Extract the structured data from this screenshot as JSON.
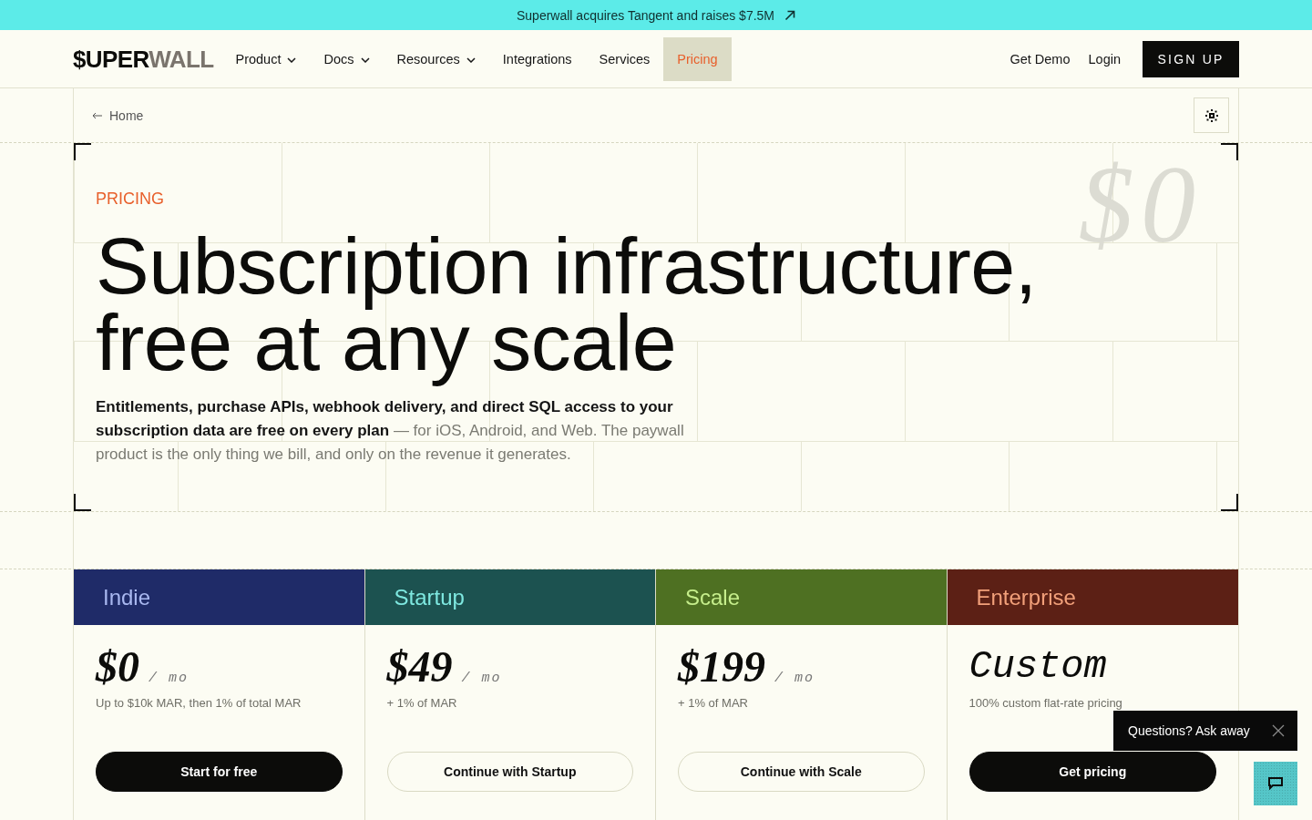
{
  "announcement": {
    "text": "Superwall acquires Tangent and raises $7.5M"
  },
  "nav": {
    "logo": {
      "primary": "$UPER",
      "secondary": "WALL"
    },
    "items": [
      {
        "label": "Product",
        "has_menu": true,
        "selected": false
      },
      {
        "label": "Docs",
        "has_menu": true,
        "selected": false
      },
      {
        "label": "Resources",
        "has_menu": true,
        "selected": false
      },
      {
        "label": "Integrations",
        "has_menu": false,
        "selected": false
      },
      {
        "label": "Services",
        "has_menu": false,
        "selected": false
      },
      {
        "label": "Pricing",
        "has_menu": false,
        "selected": true
      }
    ],
    "actions": [
      {
        "label": "Get Demo",
        "kind": "link"
      },
      {
        "label": "Login",
        "kind": "link"
      },
      {
        "label": "SIGN UP",
        "kind": "button"
      }
    ]
  },
  "breadcrumb": {
    "label": "Home"
  },
  "hero": {
    "eyebrow": "PRICING",
    "watermark": "$0",
    "title_lines": [
      "Subscription infrastructure,",
      "free at any scale"
    ],
    "description": "**Entitlements, purchase APIs, webhook delivery, and direct SQL access to your subscription data are free on every plan** — for iOS, Android, and Web. The paywall product is the only thing we bill, and only on the revenue it generates."
  },
  "plans": [
    {
      "name": {
        "text": "Indie",
        "color": "#a9b8f0"
      },
      "color": "#1f2b68",
      "kind": "amount",
      "price": "$0",
      "period": "/ mo",
      "note": "Up to $10k MAR, then 1% of total MAR",
      "cta": {
        "label": "Start for free",
        "primary": true
      }
    },
    {
      "name": {
        "text": "Startup",
        "color": "#7ee8e0"
      },
      "color": "#1c5250",
      "kind": "amount",
      "price": "$49",
      "period": "/ mo",
      "note": "+ 1% of MAR",
      "cta": {
        "label": "Continue with Startup",
        "primary": false
      }
    },
    {
      "name": {
        "text": "Scale",
        "color": "#c6ee8c"
      },
      "color": "#4e7022",
      "kind": "amount",
      "price": "$199",
      "period": "/ mo",
      "note": "+ 1% of MAR",
      "cta": {
        "label": "Continue with Scale",
        "primary": false
      }
    },
    {
      "name": {
        "text": "Enterprise",
        "color": "#f2a07a"
      },
      "color": "#5c2015",
      "kind": "custom",
      "price": "Custom",
      "note": "100% custom flat-rate pricing",
      "cta": {
        "label": "Get pricing",
        "primary": true
      }
    }
  ],
  "chat": {
    "prompt": "Questions? Ask away"
  }
}
